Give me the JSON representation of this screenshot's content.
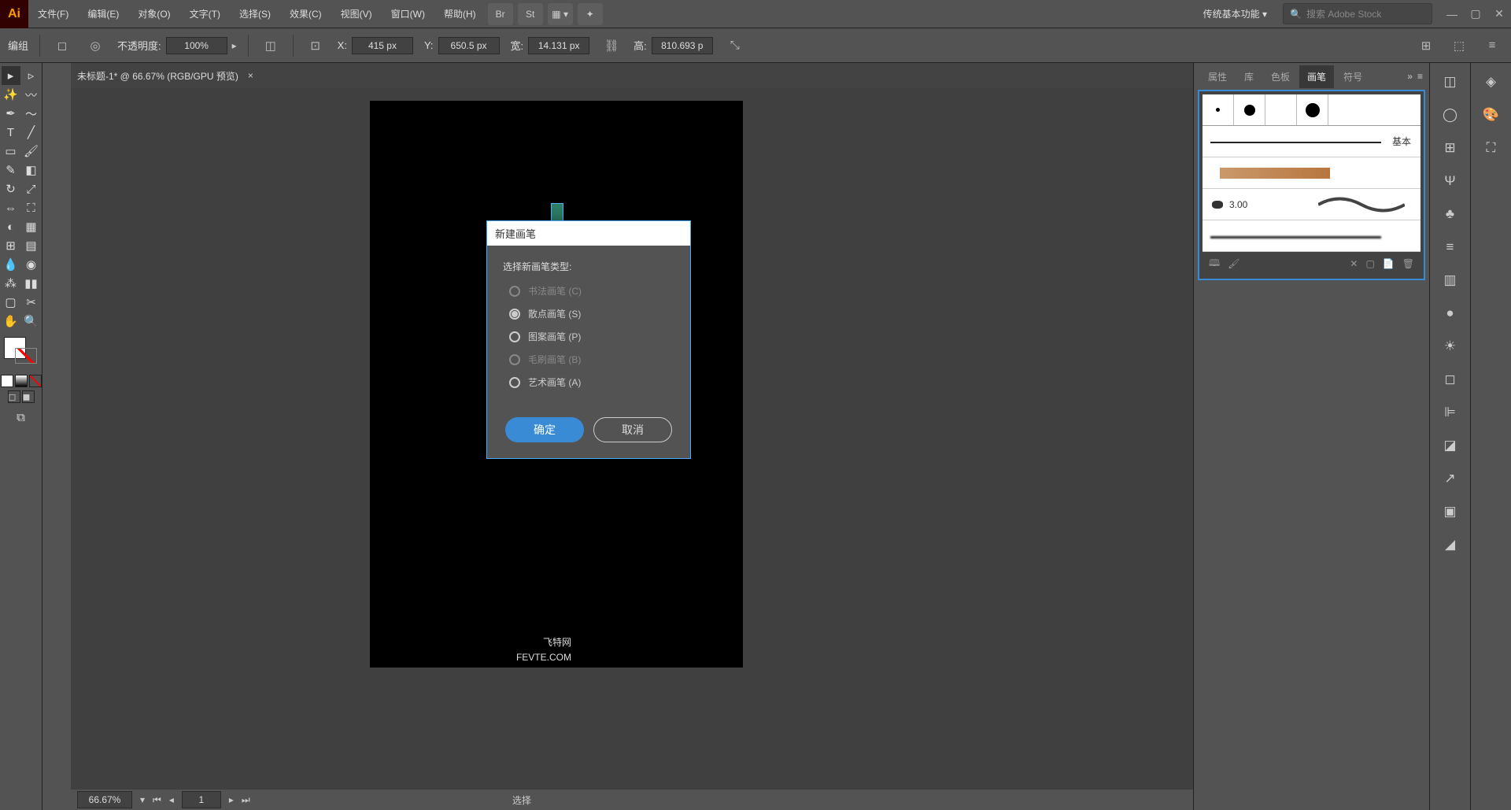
{
  "app": {
    "logo": "Ai"
  },
  "menu": {
    "items": [
      "文件(F)",
      "编辑(E)",
      "对象(O)",
      "文字(T)",
      "选择(S)",
      "效果(C)",
      "视图(V)",
      "窗口(W)",
      "帮助(H)"
    ],
    "bridge": "Br",
    "stock": "St",
    "workspace": "传统基本功能",
    "search_placeholder": "搜索 Adobe Stock"
  },
  "controlbar": {
    "mode": "编组",
    "opacity_label": "不透明度:",
    "opacity_value": "100%",
    "x_label": "X:",
    "x_value": "415 px",
    "y_label": "Y:",
    "y_value": "650.5 px",
    "w_label": "宽:",
    "w_value": "14.131 px",
    "h_label": "高:",
    "h_value": "810.693 p"
  },
  "document": {
    "tab_title": "未标题-1* @ 66.67% (RGB/GPU 预览)"
  },
  "status": {
    "zoom": "66.67%",
    "artboard": "1",
    "selection": "选择",
    "watermark_site": "FEVTE.COM",
    "watermark_name": "飞特网"
  },
  "panel": {
    "tabs": [
      "属性",
      "库",
      "色板",
      "画笔",
      "符号"
    ],
    "active_tab_index": 3,
    "basic_label": "基本",
    "calli_size": "3.00"
  },
  "dialog": {
    "title": "新建画笔",
    "heading": "选择新画笔类型:",
    "options": [
      {
        "label": "书法画笔 (C)",
        "disabled": true,
        "checked": false
      },
      {
        "label": "散点画笔 (S)",
        "disabled": false,
        "checked": true
      },
      {
        "label": "图案画笔 (P)",
        "disabled": false,
        "checked": false
      },
      {
        "label": "毛刷画笔 (B)",
        "disabled": true,
        "checked": false
      },
      {
        "label": "艺术画笔 (A)",
        "disabled": false,
        "checked": false
      }
    ],
    "ok": "确定",
    "cancel": "取消"
  }
}
